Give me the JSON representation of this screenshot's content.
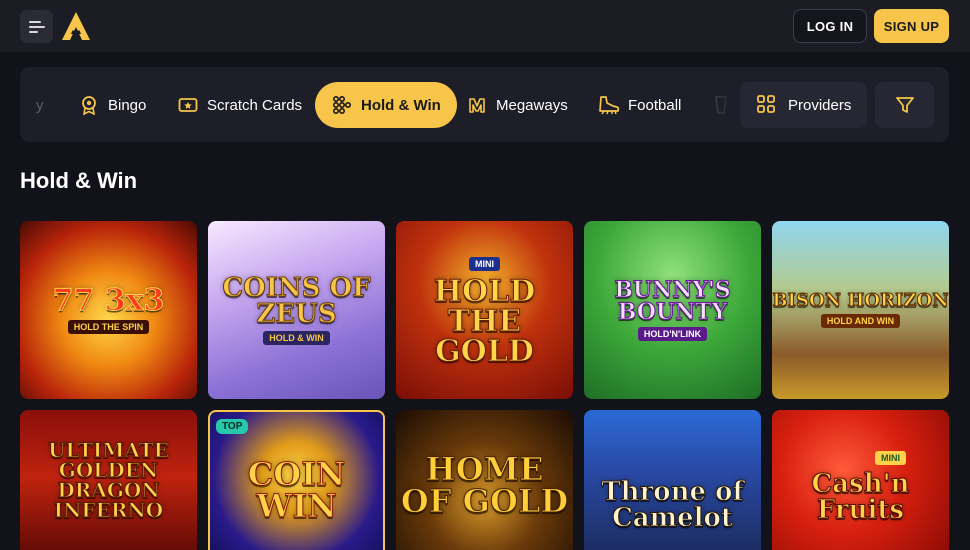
{
  "header": {
    "menu_icon": "hamburger-menu-icon",
    "logo_icon": "brand-logo-a",
    "login_label": "LOG IN",
    "signup_label": "SIGN UP",
    "accent_color": "#f6c54a"
  },
  "categories": {
    "clipped_left": "y",
    "items": [
      {
        "label": "Bingo",
        "icon": "bingo-icon"
      },
      {
        "label": "Scratch Cards",
        "icon": "scratch-cards-icon"
      },
      {
        "label": "Hold & Win",
        "icon": "hold-win-icon",
        "active": true
      },
      {
        "label": "Megaways",
        "icon": "megaways-icon"
      },
      {
        "label": "Football",
        "icon": "football-boot-icon"
      }
    ],
    "providers_label": "Providers",
    "filter_icon": "filter-icon"
  },
  "section": {
    "title": "Hold & Win"
  },
  "games": [
    {
      "title": "77 3x3",
      "subtitle": "HOLD THE SPIN"
    },
    {
      "title": "COINS OF ZEUS",
      "subtitle": "HOLD & WIN"
    },
    {
      "title": "HOLD THE GOLD",
      "subtitle": "MINI"
    },
    {
      "title": "BUNNY'S BOUNTY",
      "subtitle": "HOLD'N'LINK"
    },
    {
      "title": "BISON HORIZON",
      "subtitle": "HOLD AND WIN"
    },
    {
      "title": "ULTIMATE GOLDEN DRAGON INFERNO",
      "subtitle": ""
    },
    {
      "title": "COIN WIN",
      "subtitle": "",
      "badge": "TOP"
    },
    {
      "title": "HOME OF GOLD",
      "subtitle": ""
    },
    {
      "title": "Throne of Camelot",
      "subtitle": ""
    },
    {
      "title": "Cash'n Fruits",
      "subtitle": "MINI"
    }
  ]
}
